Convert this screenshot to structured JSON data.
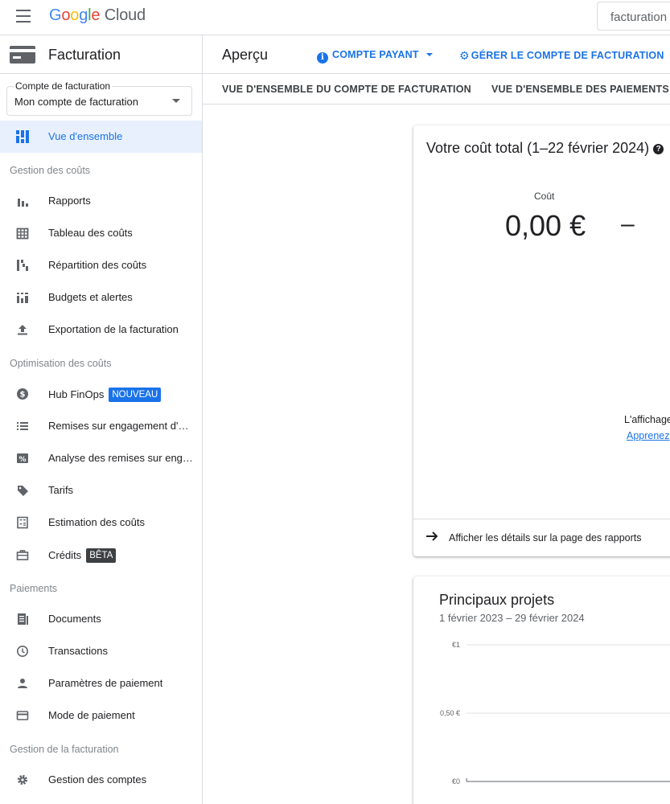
{
  "topbar": {
    "logo_letters": [
      "G",
      "o",
      "o",
      "g",
      "l",
      "e"
    ],
    "logo_product": "Cloud",
    "search_value": "facturation"
  },
  "sidebar": {
    "title": "Facturation",
    "account_select": {
      "label": "Compte de facturation",
      "value": "Mon compte de facturation"
    },
    "items": [
      {
        "label": "Vue d'ensemble",
        "icon": "dashboard-icon",
        "active": true
      },
      {
        "label": "Rapports",
        "icon": "bar-chart-icon"
      },
      {
        "label": "Tableau des coûts",
        "icon": "table-icon"
      },
      {
        "label": "Répartition des coûts",
        "icon": "breakdown-icon"
      },
      {
        "label": "Budgets et alertes",
        "icon": "budget-icon"
      },
      {
        "label": "Exportation de la facturation",
        "icon": "upload-icon"
      },
      {
        "label": "Hub FinOps",
        "icon": "dollar-icon",
        "badge": "NOUVEAU"
      },
      {
        "label": "Remises sur engagement d'…",
        "icon": "list-icon"
      },
      {
        "label": "Analyse des remises sur eng…",
        "icon": "percent-icon"
      },
      {
        "label": "Tarifs",
        "icon": "tag-icon"
      },
      {
        "label": "Estimation des coûts",
        "icon": "calculator-icon"
      },
      {
        "label": "Crédits",
        "icon": "gift-icon",
        "badge": "BÊTA"
      },
      {
        "label": "Documents",
        "icon": "document-icon"
      },
      {
        "label": "Transactions",
        "icon": "clock-icon"
      },
      {
        "label": "Paramètres de paiement",
        "icon": "person-icon"
      },
      {
        "label": "Mode de paiement",
        "icon": "credit-card-icon"
      },
      {
        "label": "Gestion des comptes",
        "icon": "gear-icon"
      }
    ],
    "sections": {
      "cost_management": "Gestion des coûts",
      "cost_optimization": "Optimisation des coûts",
      "payments": "Paiements",
      "billing_management": "Gestion de la facturation"
    }
  },
  "main": {
    "page_title": "Aperçu",
    "account_type": "COMPTE PAYANT",
    "manage_account": "GÉRER LE COMPTE DE FACTURATION",
    "tabs": [
      "VUE D'ENSEMBLE DU COMPTE DE FACTURATION",
      "VUE D'ENSEMBLE DES PAIEMENTS"
    ],
    "total_cost_card": {
      "title": "Votre coût total (1–22 février 2024)",
      "cost_label": "Coût",
      "cost_value": "0,00 €",
      "trend_value": "–",
      "notice": "L'affichage",
      "learn_more": "Apprenez",
      "footer_link": "Afficher les détails sur la page des rapports"
    },
    "top_projects_card": {
      "title": "Principaux projets",
      "date_range": "1 février 2023 – 29 février 2024"
    }
  },
  "chart_data": {
    "type": "bar",
    "title": "Principaux projets",
    "subtitle": "1 février 2023 – 29 février 2024",
    "yticks": [
      "€1",
      "0,50 €",
      "€0"
    ],
    "ytick_values": [
      1,
      0.5,
      0
    ],
    "ylim": [
      0,
      1
    ],
    "grid": true,
    "series": []
  },
  "colors": {
    "accent": "#1a73e8",
    "active_bg": "#e8f0fe",
    "badge_dark": "#3c4043"
  }
}
